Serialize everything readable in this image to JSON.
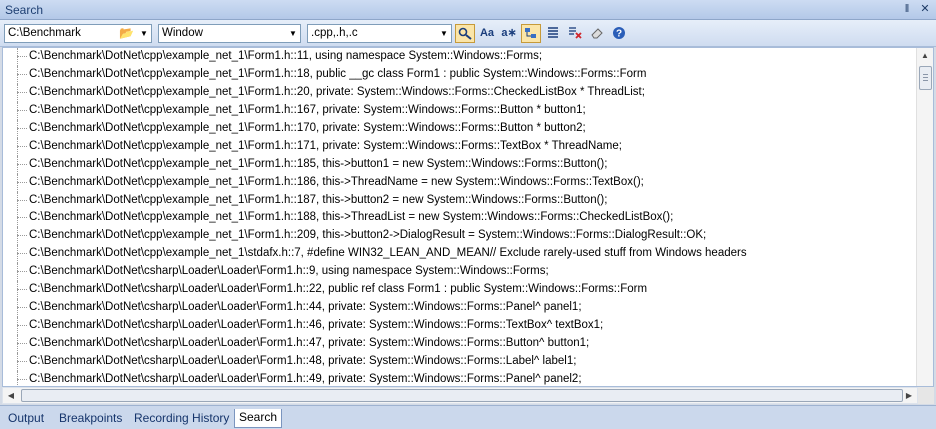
{
  "panel": {
    "title": "Search"
  },
  "toolbar": {
    "location": "C:\\Benchmark",
    "scope": "Window",
    "filetypes": ".cpp,.h,.c"
  },
  "results": [
    "C:\\Benchmark\\DotNet\\cpp\\example_net_1\\Form1.h::11, using namespace System::Windows::Forms;",
    "C:\\Benchmark\\DotNet\\cpp\\example_net_1\\Form1.h::18, public __gc class Form1 : public System::Windows::Forms::Form",
    "C:\\Benchmark\\DotNet\\cpp\\example_net_1\\Form1.h::20, private: System::Windows::Forms::CheckedListBox * ThreadList;",
    "C:\\Benchmark\\DotNet\\cpp\\example_net_1\\Form1.h::167, private: System::Windows::Forms::Button * button1;",
    "C:\\Benchmark\\DotNet\\cpp\\example_net_1\\Form1.h::170, private: System::Windows::Forms::Button * button2;",
    "C:\\Benchmark\\DotNet\\cpp\\example_net_1\\Form1.h::171, private: System::Windows::Forms::TextBox * ThreadName;",
    "C:\\Benchmark\\DotNet\\cpp\\example_net_1\\Form1.h::185, this->button1 = new System::Windows::Forms::Button();",
    "C:\\Benchmark\\DotNet\\cpp\\example_net_1\\Form1.h::186, this->ThreadName = new System::Windows::Forms::TextBox();",
    "C:\\Benchmark\\DotNet\\cpp\\example_net_1\\Form1.h::187, this->button2 = new System::Windows::Forms::Button();",
    "C:\\Benchmark\\DotNet\\cpp\\example_net_1\\Form1.h::188, this->ThreadList = new System::Windows::Forms::CheckedListBox();",
    "C:\\Benchmark\\DotNet\\cpp\\example_net_1\\Form1.h::209, this->button2->DialogResult = System::Windows::Forms::DialogResult::OK;",
    "C:\\Benchmark\\DotNet\\cpp\\example_net_1\\stdafx.h::7, #define WIN32_LEAN_AND_MEAN// Exclude rarely-used stuff from Windows headers",
    "C:\\Benchmark\\DotNet\\csharp\\Loader\\Loader\\Form1.h::9, using namespace System::Windows::Forms;",
    "C:\\Benchmark\\DotNet\\csharp\\Loader\\Loader\\Form1.h::22, public ref class Form1 : public System::Windows::Forms::Form",
    "C:\\Benchmark\\DotNet\\csharp\\Loader\\Loader\\Form1.h::44, private: System::Windows::Forms::Panel^ panel1;",
    "C:\\Benchmark\\DotNet\\csharp\\Loader\\Loader\\Form1.h::46, private: System::Windows::Forms::TextBox^ textBox1;",
    "C:\\Benchmark\\DotNet\\csharp\\Loader\\Loader\\Form1.h::47, private: System::Windows::Forms::Button^ button1;",
    "C:\\Benchmark\\DotNet\\csharp\\Loader\\Loader\\Form1.h::48, private: System::Windows::Forms::Label^ label1;",
    "C:\\Benchmark\\DotNet\\csharp\\Loader\\Loader\\Form1.h::49, private: System::Windows::Forms::Panel^ panel2;"
  ],
  "tabs": [
    {
      "label": "Output"
    },
    {
      "label": "Breakpoints"
    },
    {
      "label": "Recording History"
    },
    {
      "label": "Search"
    }
  ],
  "icons": {
    "pin": "pin-icon",
    "close": "close-icon",
    "folder": "folder-open-icon"
  },
  "colors": {
    "accent": "#fbe5a8",
    "title": "#1e3f72"
  }
}
